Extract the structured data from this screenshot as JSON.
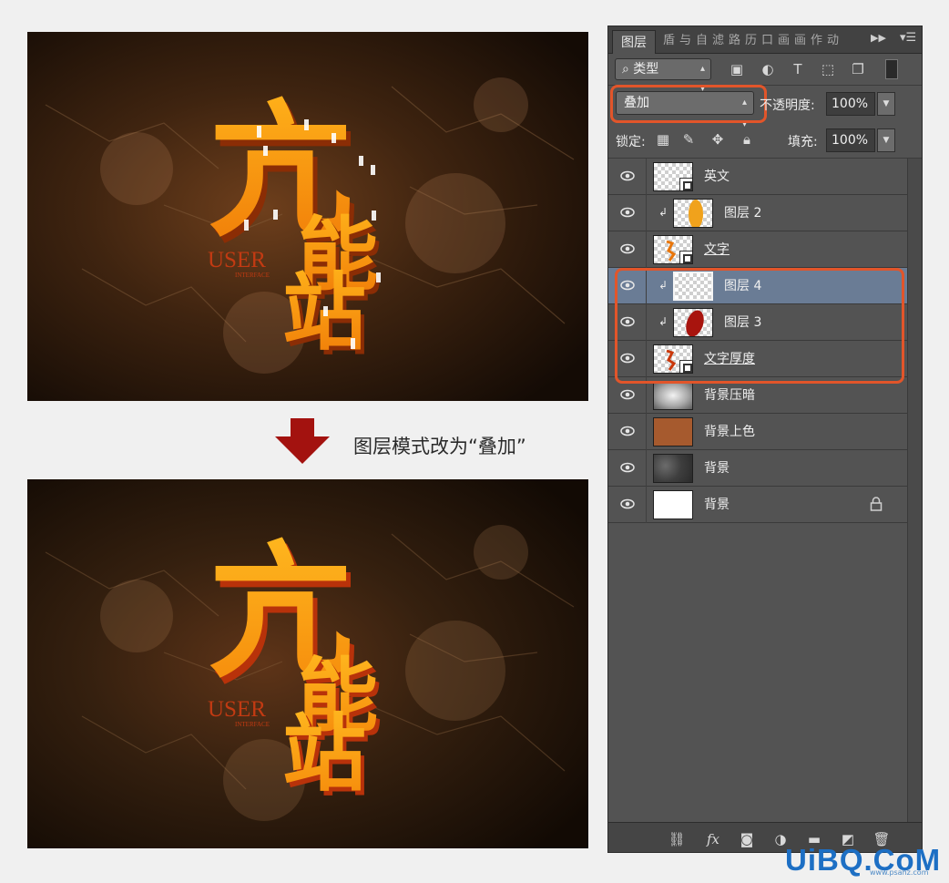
{
  "caption": "图层模式改为“叠加”",
  "artwork": {
    "title_glyph_1": "亢",
    "title_glyph_2": "能",
    "title_glyph_3": "站",
    "user_text": "USER",
    "interface_text": "INTERFACE"
  },
  "layers_panel": {
    "tabs": [
      "图层",
      "盾",
      "与",
      "自",
      "滤",
      "路",
      "历",
      "口",
      "画",
      "画",
      "作",
      "动"
    ],
    "filter": {
      "kind_label": "类型",
      "icons": [
        "image-filter-icon",
        "adjustment-filter-icon",
        "type-filter-icon",
        "shape-filter-icon",
        "smart-object-filter-icon"
      ]
    },
    "blend_mode": "叠加",
    "opacity_label": "不透明度:",
    "opacity_value": "100%",
    "lock_label": "锁定:",
    "fill_label": "填充:",
    "fill_value": "100%",
    "layers": [
      {
        "name": "英文",
        "thumb": "checker",
        "clipped": false,
        "selected": false,
        "underline": false
      },
      {
        "name": "图层 2",
        "thumb": "orange-brush",
        "clipped": true,
        "selected": false,
        "underline": false
      },
      {
        "name": "文字",
        "thumb": "text",
        "clipped": false,
        "selected": false,
        "underline": true
      },
      {
        "name": "图层 4",
        "thumb": "checker",
        "clipped": true,
        "selected": true,
        "underline": false
      },
      {
        "name": "图层 3",
        "thumb": "red-brush",
        "clipped": true,
        "selected": false,
        "underline": false
      },
      {
        "name": "文字厚度",
        "thumb": "text",
        "clipped": false,
        "selected": false,
        "underline": true
      },
      {
        "name": "背景压暗",
        "thumb": "gradient",
        "clipped": false,
        "selected": false,
        "underline": false
      },
      {
        "name": "背景上色",
        "thumb": "brown",
        "clipped": false,
        "selected": false,
        "underline": false
      },
      {
        "name": "背景",
        "thumb": "stone",
        "clipped": false,
        "selected": false,
        "underline": false
      },
      {
        "name": "背景",
        "thumb": "white",
        "clipped": false,
        "selected": false,
        "underline": false,
        "locked": true
      }
    ],
    "bottom_icons": [
      "link-layers-icon",
      "fx-icon",
      "mask-icon",
      "adjustment-layer-icon",
      "folder-icon",
      "new-layer-icon",
      "trash-icon"
    ]
  },
  "watermark": "UiBQ.CoM",
  "watermark_sub": "www.psahz.com",
  "colors": {
    "highlight": "#e2552a",
    "selected_layer": "#6a7c95",
    "panel_bg": "#535353",
    "arrow": "#a3120f",
    "watermark": "#1d6fc4"
  }
}
